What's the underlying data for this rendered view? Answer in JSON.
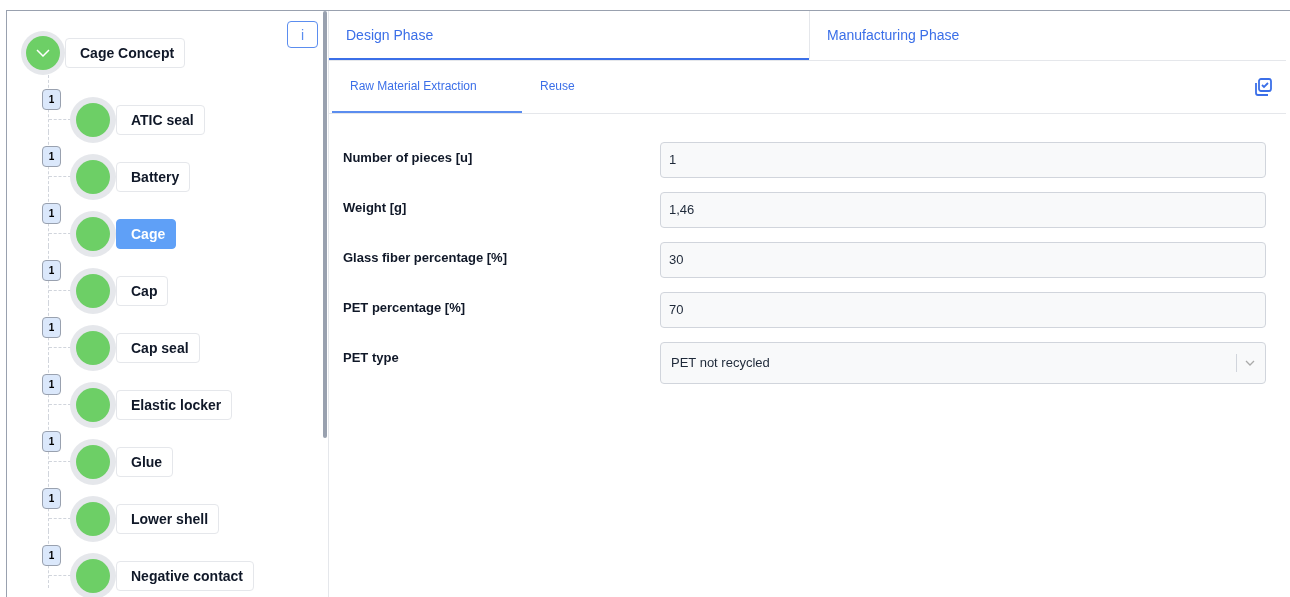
{
  "tree": {
    "label": "Cage Concept",
    "expanded": true,
    "children": [
      {
        "label": "ATIC seal",
        "badge": "1",
        "selected": false
      },
      {
        "label": "Battery",
        "badge": "1",
        "selected": false
      },
      {
        "label": "Cage",
        "badge": "1",
        "selected": true
      },
      {
        "label": "Cap",
        "badge": "1",
        "selected": false
      },
      {
        "label": "Cap seal",
        "badge": "1",
        "selected": false
      },
      {
        "label": "Elastic locker",
        "badge": "1",
        "selected": false
      },
      {
        "label": "Glue",
        "badge": "1",
        "selected": false
      },
      {
        "label": "Lower shell",
        "badge": "1",
        "selected": false
      },
      {
        "label": "Negative contact",
        "badge": "1",
        "selected": false
      }
    ]
  },
  "info_button": "i",
  "phases": [
    {
      "label": "Design Phase",
      "selected": true
    },
    {
      "label": "Manufacturing Phase",
      "selected": false
    }
  ],
  "subtabs": [
    {
      "label": "Raw Material Extraction",
      "selected": true
    },
    {
      "label": "Reuse",
      "selected": false
    }
  ],
  "fields": [
    {
      "kind": "input",
      "label": "Number of pieces [u]",
      "value": "1"
    },
    {
      "kind": "input",
      "label": "Weight [g]",
      "value": "1,46"
    },
    {
      "kind": "input",
      "label": "Glass fiber percentage [%]",
      "value": "30"
    },
    {
      "kind": "input",
      "label": "PET percentage [%]",
      "value": "70"
    },
    {
      "kind": "select",
      "label": "PET type",
      "value": "PET not recycled"
    }
  ]
}
